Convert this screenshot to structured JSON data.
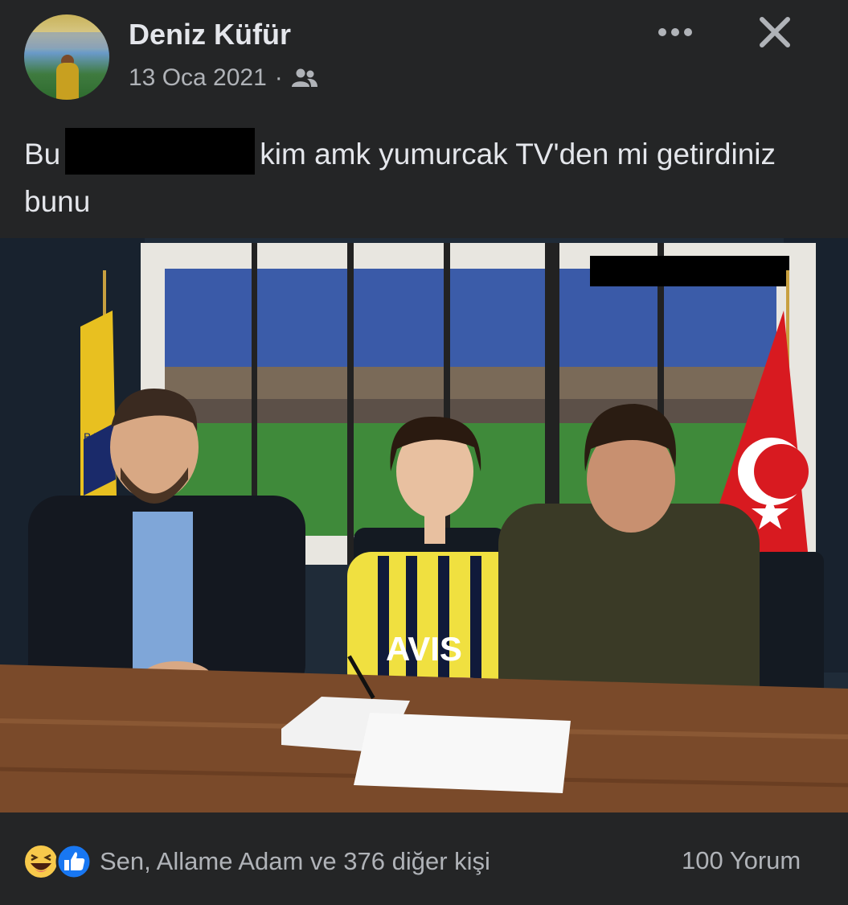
{
  "post": {
    "author": "Deniz Küfür",
    "date": "13 Oca 2021",
    "separator": "·",
    "audience_icon": "friends-icon",
    "text_before": "Bu",
    "text_after": "kim amk yumurcak TV'den mi getirdiniz bunu"
  },
  "photo": {
    "jersey_text": "AVIS",
    "flag_text": "BAH"
  },
  "footer": {
    "reactions_label": "Sen, Allame Adam ve 376 diğer kişi",
    "comments_label": "100 Yorum",
    "reaction_icons": [
      "haha-icon",
      "like-icon"
    ]
  },
  "colors": {
    "background": "#242526",
    "text": "#e4e6eb",
    "secondary_text": "#b0b3b8",
    "like_blue": "#1877f2",
    "haha_yellow": "#f7c94b"
  }
}
